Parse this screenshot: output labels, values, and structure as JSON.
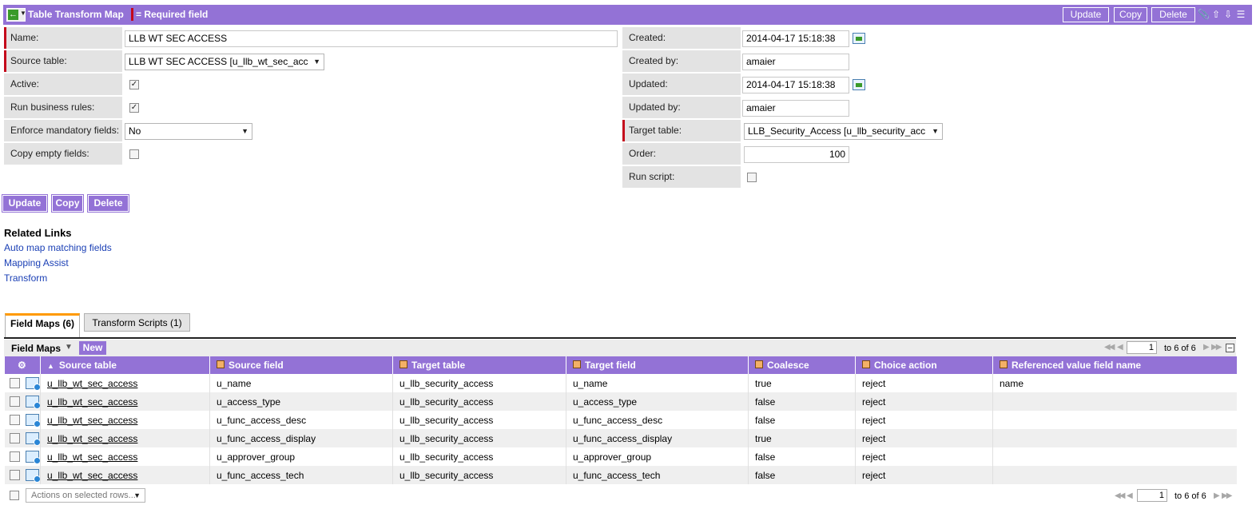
{
  "title_bar": {
    "title": "Table Transform Map",
    "required_legend": "= Required field",
    "buttons": {
      "update": "Update",
      "copy": "Copy",
      "delete": "Delete"
    },
    "icons": [
      "back-icon",
      "attachment-icon",
      "up-arrow-icon",
      "down-arrow-icon",
      "list-icon"
    ]
  },
  "form": {
    "name": {
      "label": "Name:",
      "value": "LLB WT SEC ACCESS"
    },
    "source_table": {
      "label": "Source table:",
      "value": "LLB WT SEC ACCESS [u_llb_wt_sec_acc"
    },
    "active": {
      "label": "Active:",
      "checked": true
    },
    "run_business_rules": {
      "label": "Run business rules:",
      "checked": true
    },
    "enforce_mandatory": {
      "label": "Enforce mandatory fields:",
      "value": "No"
    },
    "copy_empty": {
      "label": "Copy empty fields:",
      "checked": false
    },
    "created": {
      "label": "Created:",
      "value": "2014-04-17 15:18:38"
    },
    "created_by": {
      "label": "Created by:",
      "value": "amaier"
    },
    "updated": {
      "label": "Updated:",
      "value": "2014-04-17 15:18:38"
    },
    "updated_by": {
      "label": "Updated by:",
      "value": "amaier"
    },
    "target_table": {
      "label": "Target table:",
      "value": "LLB_Security_Access [u_llb_security_acc"
    },
    "order": {
      "label": "Order:",
      "value": "100"
    },
    "run_script": {
      "label": "Run script:",
      "checked": false
    }
  },
  "form_buttons": {
    "update": "Update",
    "copy": "Copy",
    "delete": "Delete"
  },
  "related_links": {
    "title": "Related Links",
    "links": [
      "Auto map matching fields",
      "Mapping Assist",
      "Transform"
    ]
  },
  "tabs": [
    {
      "label": "Field Maps (6)",
      "active": true
    },
    {
      "label": "Transform Scripts (1)",
      "active": false
    }
  ],
  "list": {
    "title": "Field Maps",
    "new_label": "New",
    "page_value": "1",
    "range_text": "to 6 of 6",
    "columns": [
      "Source table",
      "Source field",
      "Target table",
      "Target field",
      "Coalesce",
      "Choice action",
      "Referenced value field name"
    ],
    "rows": [
      [
        "u_llb_wt_sec_access",
        "u_name",
        "u_llb_security_access",
        "u_name",
        "true",
        "reject",
        "name"
      ],
      [
        "u_llb_wt_sec_access",
        "u_access_type",
        "u_llb_security_access",
        "u_access_type",
        "false",
        "reject",
        ""
      ],
      [
        "u_llb_wt_sec_access",
        "u_func_access_desc",
        "u_llb_security_access",
        "u_func_access_desc",
        "false",
        "reject",
        ""
      ],
      [
        "u_llb_wt_sec_access",
        "u_func_access_display",
        "u_llb_security_access",
        "u_func_access_display",
        "true",
        "reject",
        ""
      ],
      [
        "u_llb_wt_sec_access",
        "u_approver_group",
        "u_llb_security_access",
        "u_approver_group",
        "false",
        "reject",
        ""
      ],
      [
        "u_llb_wt_sec_access",
        "u_func_access_tech",
        "u_llb_security_access",
        "u_func_access_tech",
        "false",
        "reject",
        ""
      ]
    ],
    "actions_placeholder": "Actions on selected rows..."
  },
  "colors": {
    "header": "#9372d6",
    "required": "#c4081b",
    "link": "#1a3fb5",
    "active_tab": "#ff9a00"
  }
}
